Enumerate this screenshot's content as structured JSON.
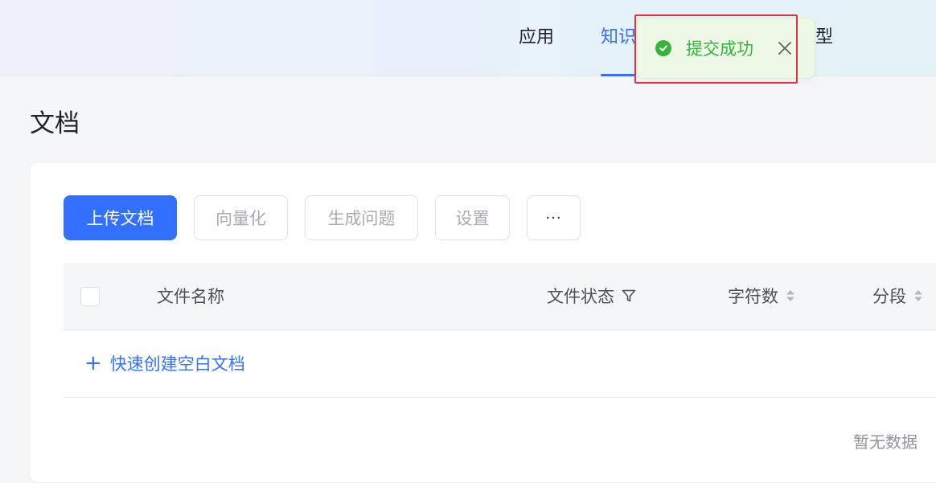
{
  "nav": {
    "tabs": [
      {
        "label": "应用"
      },
      {
        "label": "知识库"
      },
      {
        "label": "模型"
      }
    ]
  },
  "toast": {
    "message": "提交成功",
    "icon": "check-circle-icon",
    "close_icon": "close-icon"
  },
  "page": {
    "title": "文档"
  },
  "toolbar": {
    "upload_label": "上传文档",
    "vectorize_label": "向量化",
    "generate_label": "生成问题",
    "settings_label": "设置",
    "more_label": "···"
  },
  "table": {
    "columns": [
      {
        "label": "文件名称"
      },
      {
        "label": "文件状态"
      },
      {
        "label": "字符数"
      },
      {
        "label": "分段"
      }
    ],
    "quick_create_label": "快速创建空白文档",
    "empty_text": "暂无数据"
  },
  "colors": {
    "primary": "#3370ff",
    "success": "#34b53a",
    "highlight": "#e8303a"
  }
}
